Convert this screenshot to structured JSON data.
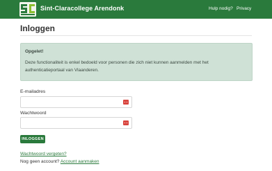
{
  "header": {
    "logo_text": "SC",
    "brand": "Sint-Claracollege Arendonk",
    "nav": {
      "help": "Hulp nodig?",
      "privacy": "Privacy"
    }
  },
  "page": {
    "title": "Inloggen"
  },
  "alert": {
    "title": "Opgelet!",
    "text": "Deze functionaliteit is enkel bedoeld voor personen die zich niet kunnen aanmelden met het authenticatieportaal van Vlaanderen."
  },
  "form": {
    "email_label": "E-mailadres",
    "email_value": "",
    "password_label": "Wachtwoord",
    "password_value": "",
    "submit_label": "INLOGGEN"
  },
  "links": {
    "forgot": "Wachtwoord vergeten?",
    "no_account": "Nog geen account?",
    "create_account": "Account aanmaken"
  },
  "icons": {
    "password_manager": "password-manager-icon"
  },
  "colors": {
    "brand_green": "#2a7a3c",
    "alert_bg": "#cfe1d6",
    "icon_red": "#d9453f"
  }
}
